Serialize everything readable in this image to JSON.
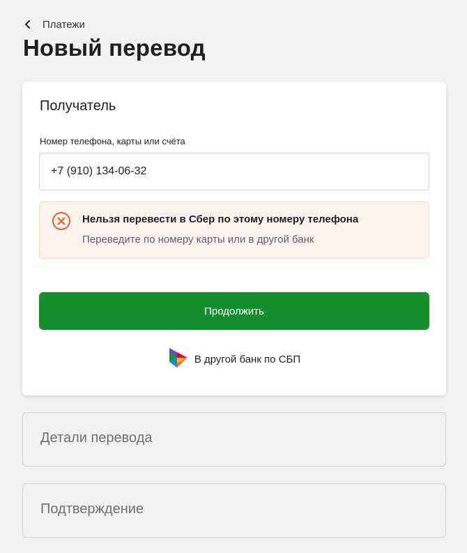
{
  "breadcrumb": {
    "label": "Платежи"
  },
  "page": {
    "title": "Новый перевод"
  },
  "recipient": {
    "title": "Получатель",
    "field_label": "Номер телефона, карты или счёта",
    "field_value": "+7 (910) 134-06-32"
  },
  "error": {
    "title": "Нельзя перевести в Сбер по этому номеру телефона",
    "text": "Переведите по номеру карты или в другой банк"
  },
  "actions": {
    "continue_label": "Продолжить",
    "sbp_label": "В другой банк по СБП"
  },
  "steps": {
    "details_label": "Детали перевода",
    "confirm_label": "Подтверждение"
  },
  "icons": {
    "back": "chevron-left-icon",
    "error": "error-circle-x-icon",
    "sbp": "sbp-logo-icon"
  },
  "colors": {
    "primary": "#158f2e",
    "error_accent": "#e0611f",
    "error_bg": "#fef3ee",
    "background": "#f2f2f2"
  }
}
